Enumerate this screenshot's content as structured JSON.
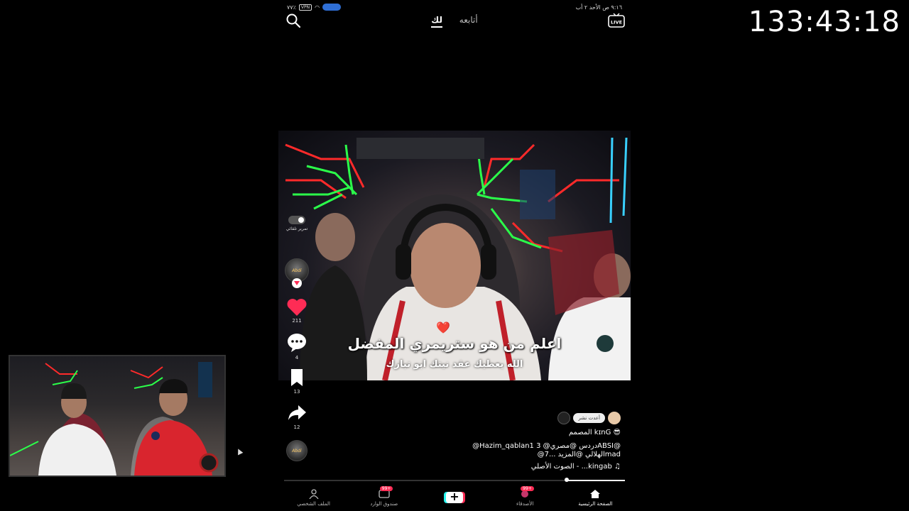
{
  "stream": {
    "timer": "133:43:18"
  },
  "status_bar": {
    "time_text": "٩:١٦ ص  الأحد ٢ أب",
    "battery_text": "٧٧٪",
    "vpn_label": "VPN"
  },
  "top_nav": {
    "tab_for_you": "لك",
    "tab_following": "أتابعه",
    "live_label": "LIVE"
  },
  "video": {
    "caption_main": "اعلم من هو ستريمري المفضل",
    "caption_sub": "الله يعطيك عقد نيتك ابو تبارك",
    "heart_emoji": "❤️"
  },
  "side_actions": {
    "autoscroll_label": "تمرير تلقائي",
    "avatar_text": "Abdi",
    "likes": "211",
    "comments": "4",
    "saves": "13",
    "shares": "12"
  },
  "post": {
    "repost_chip": "أعدت نشر",
    "author_line": "المصمم kɪnG 😎",
    "mentions_line1": "@Hazim_qablan1 دردس @مصري@ 3ABSI@",
    "mentions_line2": "@الهلالي @المزيد ...7mad",
    "sound_text": "الصوت الأصلي - ...kingab"
  },
  "progress": {
    "value": 0.17
  },
  "bottom_nav": {
    "profile": "الملف الشخصي",
    "inbox": "صندوق الوارد",
    "inbox_badge": "99+",
    "friends": "الأصدقاء",
    "friends_badge": "99+",
    "home": "الصفحة الرئيسية"
  },
  "colors": {
    "like_red": "#fe2c55",
    "accent_cyan": "#25f4ee",
    "neon_green": "#2bff4a",
    "neon_red": "#ff2a2a"
  }
}
